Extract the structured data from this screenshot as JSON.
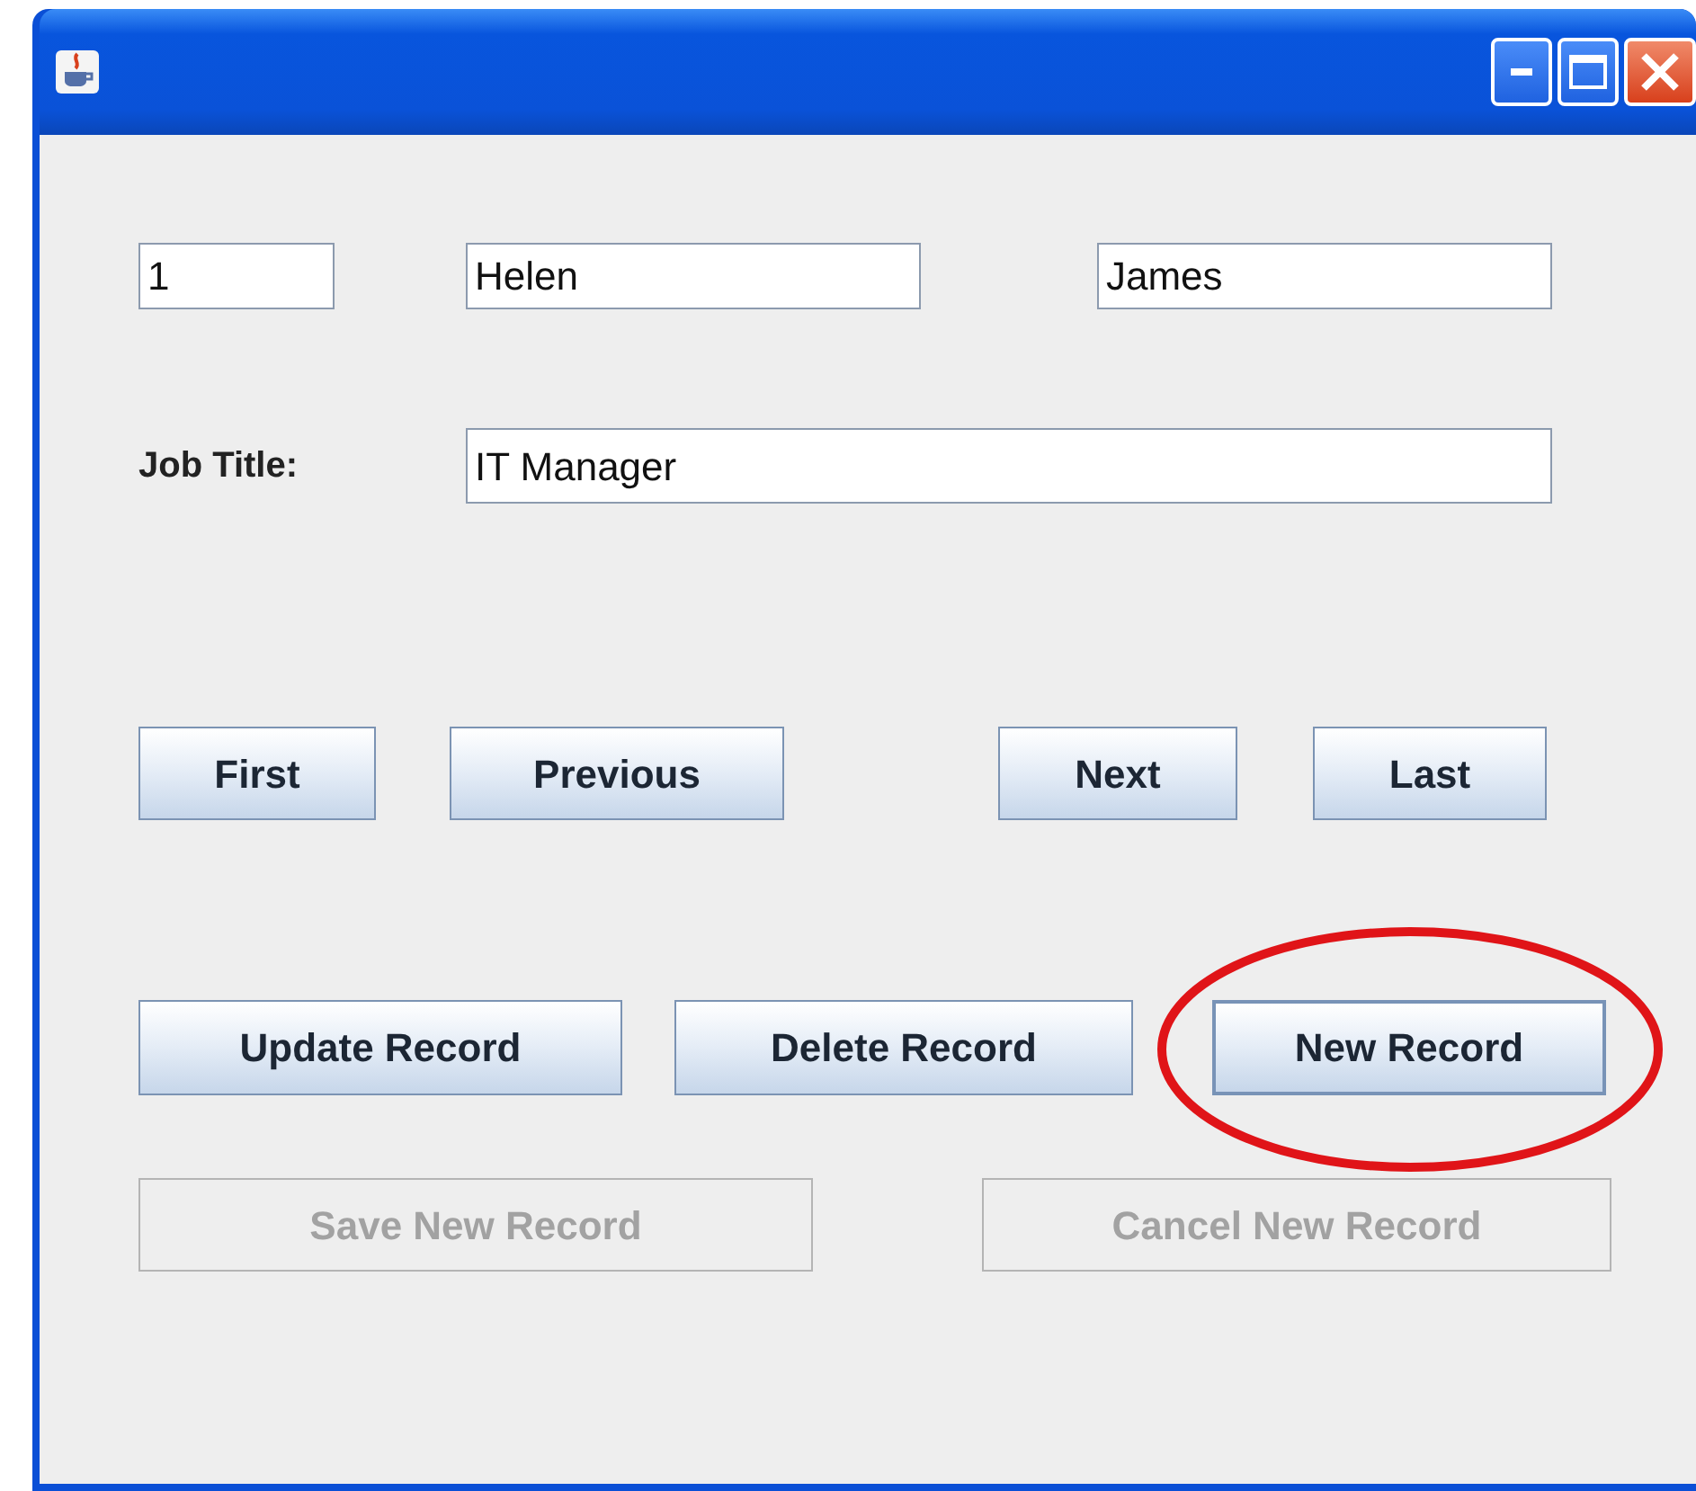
{
  "fields": [
    {
      "value": "1"
    },
    {
      "value": "Helen"
    },
    {
      "value": "James"
    }
  ],
  "job_title": {
    "label": "Job Title:",
    "value": "IT Manager"
  },
  "button_rows": [
    [
      {
        "label": "First",
        "disabled": false,
        "highlighted": false
      },
      {
        "label": "Previous",
        "disabled": false,
        "highlighted": false
      },
      {
        "label": "Next",
        "disabled": false,
        "highlighted": false
      },
      {
        "label": "Last",
        "disabled": false,
        "highlighted": false
      }
    ],
    [
      {
        "label": "Update Record",
        "disabled": false,
        "highlighted": false
      },
      {
        "label": "Delete Record",
        "disabled": false,
        "highlighted": false
      },
      {
        "label": "New Record",
        "disabled": false,
        "highlighted": true
      }
    ],
    [
      {
        "label": "Save New Record",
        "disabled": true,
        "highlighted": false
      },
      {
        "label": "Cancel New Record",
        "disabled": true,
        "highlighted": false
      }
    ]
  ]
}
